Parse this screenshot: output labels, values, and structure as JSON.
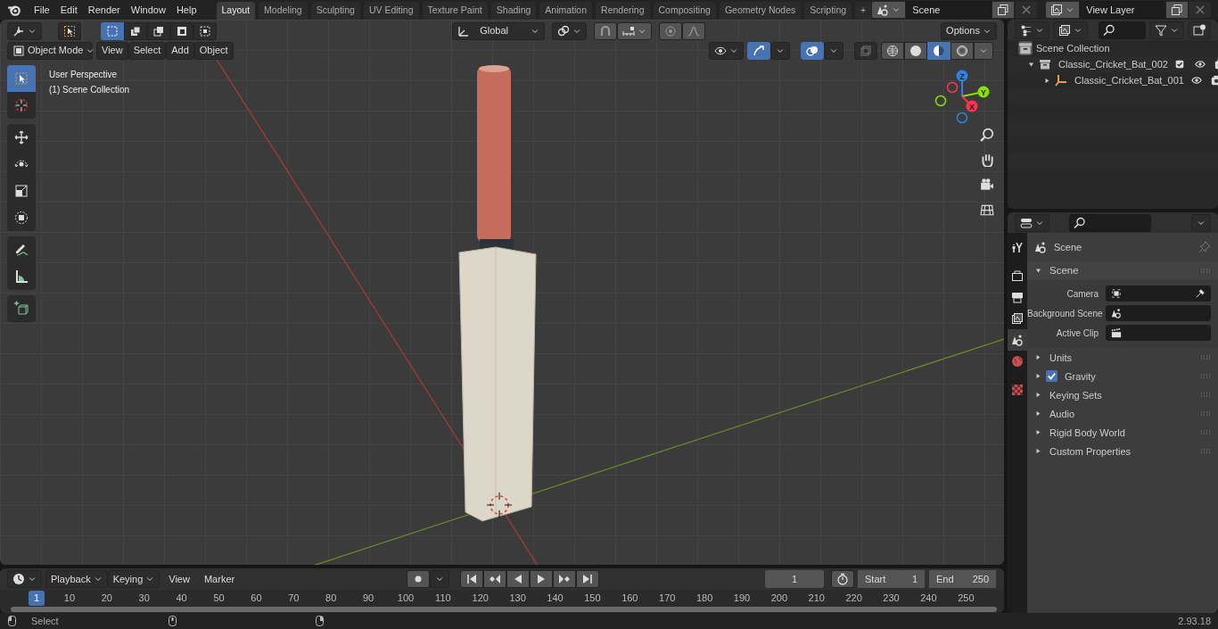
{
  "top_menu": [
    "File",
    "Edit",
    "Render",
    "Window",
    "Help"
  ],
  "workspaces": [
    {
      "label": "Layout",
      "selected": true
    },
    {
      "label": "Modeling",
      "selected": false
    },
    {
      "label": "Sculpting",
      "selected": false
    },
    {
      "label": "UV Editing",
      "selected": false
    },
    {
      "label": "Texture Paint",
      "selected": false
    },
    {
      "label": "Shading",
      "selected": false
    },
    {
      "label": "Animation",
      "selected": false
    },
    {
      "label": "Rendering",
      "selected": false
    },
    {
      "label": "Compositing",
      "selected": false
    },
    {
      "label": "Geometry Nodes",
      "selected": false
    },
    {
      "label": "Scripting",
      "selected": false
    }
  ],
  "add_workspace": "+",
  "scene_selector": {
    "value": "Scene"
  },
  "view_layer_selector": {
    "value": "View Layer"
  },
  "tool_header": {
    "select_modes": [
      {
        "selected": true
      },
      {
        "selected": false
      },
      {
        "selected": false
      },
      {
        "selected": false
      },
      {
        "selected": false
      }
    ],
    "orientation": "Global",
    "options": "Options"
  },
  "viewport_header": {
    "mode": "Object Mode",
    "menus": [
      "View",
      "Select",
      "Add",
      "Object"
    ],
    "shading_modes": [
      {
        "selected": false
      },
      {
        "selected": false
      },
      {
        "selected": true
      },
      {
        "selected": false
      }
    ]
  },
  "viewport": {
    "overlay_text": [
      "User Perspective",
      "(1) Scene Collection"
    ],
    "tool_groups": [
      [
        {
          "kind": "select",
          "selected": true
        },
        {
          "kind": "cursor",
          "selected": false
        }
      ],
      [
        {
          "kind": "move",
          "selected": false
        },
        {
          "kind": "rotate",
          "selected": false
        },
        {
          "kind": "scale",
          "selected": false
        },
        {
          "kind": "transform",
          "selected": false
        }
      ],
      [
        {
          "kind": "annotate",
          "selected": false
        },
        {
          "kind": "measure",
          "selected": false
        }
      ],
      [
        {
          "kind": "add-cube",
          "selected": false
        }
      ]
    ],
    "gizmo_axes": [
      {
        "label": "Z",
        "color": "#2f83e3"
      },
      {
        "label": "Y",
        "color": "#8bdc00"
      },
      {
        "label": "X",
        "color": "#ff3352"
      }
    ]
  },
  "outliner": {
    "root": "Scene Collection",
    "items": [
      {
        "label": "Classic_Cricket_Bat_002",
        "kind": "collection",
        "expanded": true,
        "checked": true,
        "children": [
          {
            "label": "Classic_Cricket_Bat_001",
            "kind": "empty",
            "expanded": false
          }
        ]
      }
    ]
  },
  "properties": {
    "tab_groups": [
      [
        {
          "kind": "tool",
          "selected": false
        }
      ],
      [
        {
          "kind": "render",
          "selected": false
        },
        {
          "kind": "output",
          "selected": false
        },
        {
          "kind": "view-layer",
          "selected": false
        },
        {
          "kind": "scene",
          "selected": true
        },
        {
          "kind": "world",
          "selected": false
        }
      ],
      [
        {
          "kind": "texture",
          "selected": false
        }
      ]
    ],
    "context": "Scene",
    "panel": {
      "title": "Scene",
      "expanded": true,
      "fields": [
        {
          "label": "Camera",
          "kind": "camera"
        },
        {
          "label": "Background Scene",
          "kind": "scene"
        },
        {
          "label": "Active Clip",
          "kind": "clip"
        }
      ]
    },
    "subpanels": [
      {
        "title": "Units",
        "expanded": false
      },
      {
        "title": "Gravity",
        "expanded": false,
        "checked": true
      },
      {
        "title": "Keying Sets",
        "expanded": false
      },
      {
        "title": "Audio",
        "expanded": false
      },
      {
        "title": "Rigid Body World",
        "expanded": false
      },
      {
        "title": "Custom Properties",
        "expanded": false
      }
    ]
  },
  "timeline": {
    "menus": [
      "Playback",
      "Keying"
    ],
    "plain_menus": [
      "View",
      "Marker"
    ],
    "current_frame": "1",
    "start": {
      "label": "Start",
      "value": "1"
    },
    "end": {
      "label": "End",
      "value": "250"
    },
    "ruler": {
      "current": "1",
      "ticks": [
        "10",
        "20",
        "30",
        "40",
        "50",
        "60",
        "70",
        "80",
        "90",
        "100",
        "110",
        "120",
        "130",
        "140",
        "150",
        "160",
        "170",
        "180",
        "190",
        "200",
        "210",
        "220",
        "230",
        "240",
        "250"
      ]
    }
  },
  "status_bar": {
    "hint": "Select",
    "version": "2.93.18"
  }
}
